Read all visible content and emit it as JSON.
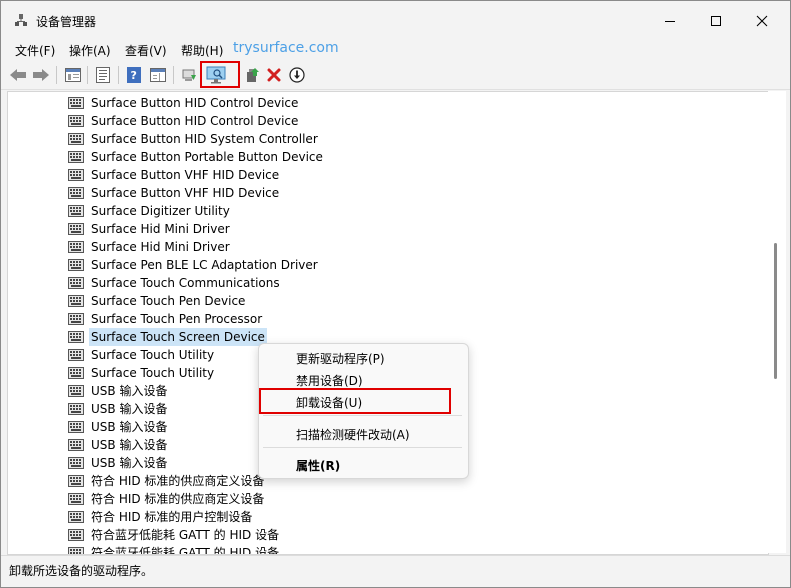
{
  "window": {
    "title": "设备管理器"
  },
  "menu": {
    "items": [
      "文件(F)",
      "操作(A)",
      "查看(V)",
      "帮助(H)"
    ],
    "watermark": "trysurface.com"
  },
  "toolbar": {
    "icons": [
      "back-arrow-icon",
      "forward-arrow-icon",
      "show-hide-tree-icon",
      "properties-icon",
      "help-icon",
      "action-pane-icon",
      "update-driver-icon",
      "scan-hardware-changes-icon",
      "add-legacy-hardware-icon",
      "uninstall-device-icon",
      "disable-device-icon"
    ],
    "highlighted": "scan-hardware-changes-icon"
  },
  "tree": {
    "items": [
      "Surface Button HID Control Device",
      "Surface Button HID Control Device",
      "Surface Button HID System Controller",
      "Surface Button Portable Button Device",
      "Surface Button VHF HID Device",
      "Surface Button VHF HID Device",
      "Surface Digitizer Utility",
      "Surface Hid Mini Driver",
      "Surface Hid Mini Driver",
      "Surface Pen BLE LC Adaptation Driver",
      "Surface Touch Communications",
      "Surface Touch Pen Device",
      "Surface Touch Pen Processor",
      "Surface Touch Screen Device",
      "Surface Touch Utility",
      "Surface Touch Utility",
      "USB 输入设备",
      "USB 输入设备",
      "USB 输入设备",
      "USB 输入设备",
      "USB 输入设备",
      "符合 HID 标准的供应商定义设备",
      "符合 HID 标准的供应商定义设备",
      "符合 HID 标准的用户控制设备",
      "符合蓝牙低能耗 GATT 的 HID 设备",
      "符合蓝牙低能耗 GATT 的 HID 设备"
    ],
    "selected": "Surface Touch Screen Device"
  },
  "context_menu": {
    "update_driver": "更新驱动程序(P)",
    "disable": "禁用设备(D)",
    "uninstall": "卸载设备(U)",
    "scan": "扫描检测硬件改动(A)",
    "properties": "属性(R)",
    "highlighted": "卸载设备(U)"
  },
  "status": {
    "text": "卸载所选设备的驱动程序。"
  },
  "colors": {
    "highlight": "#e00000",
    "selection": "#cce4f7",
    "watermark": "#4da0e6"
  }
}
